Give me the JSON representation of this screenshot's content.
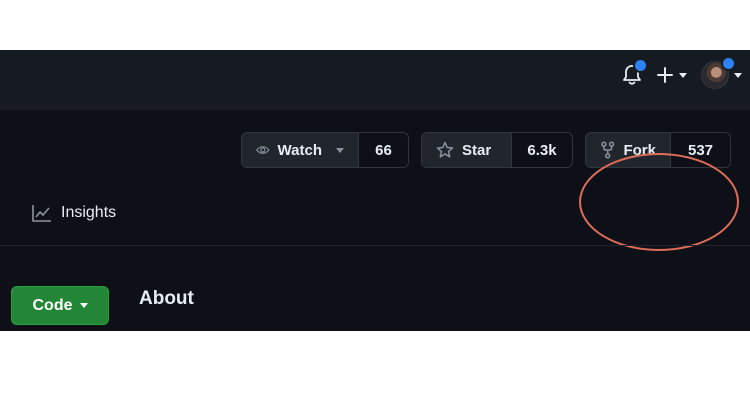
{
  "header": {
    "icons": [
      "bell-icon",
      "plus-icon",
      "avatar"
    ],
    "notification_color": "#2f81f7"
  },
  "repo_actions": {
    "watch": {
      "label": "Watch",
      "count": "66",
      "icon": "eye-icon"
    },
    "star": {
      "label": "Star",
      "count": "6.3k",
      "icon": "star-icon"
    },
    "fork": {
      "label": "Fork",
      "count": "537",
      "icon": "fork-icon"
    }
  },
  "nav": {
    "insights_label": "Insights",
    "insights_icon": "graph-icon"
  },
  "main": {
    "code_button_label": "Code",
    "code_button_color": "#238636",
    "about_heading": "About"
  },
  "annotation": {
    "color": "#e06c5a",
    "target": "fork"
  }
}
